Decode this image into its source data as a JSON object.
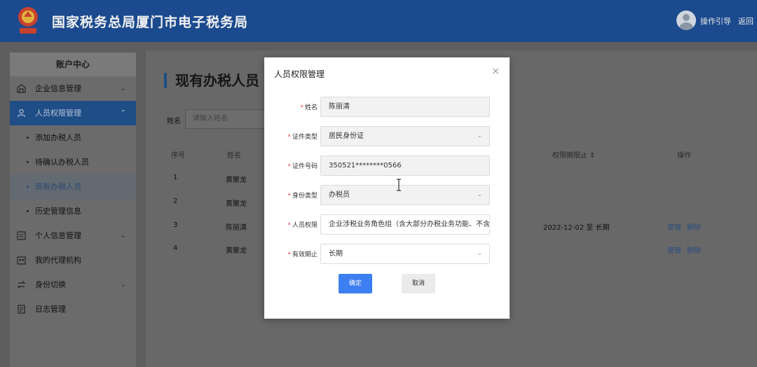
{
  "header": {
    "title": "国家税务总局厦门市电子税务局",
    "guide_label": "操作引导",
    "back_label": "返回",
    "brand_color": "#1b4a8e"
  },
  "sidebar": {
    "heading": "账户中心",
    "items": [
      {
        "label": "企业信息管理",
        "icon": "building-icon",
        "has_chevron": true
      },
      {
        "label": "人员权限管理",
        "icon": "users-icon",
        "has_chevron": true,
        "active": true
      },
      {
        "label": "添加办税人员"
      },
      {
        "label": "待确认办税人员"
      },
      {
        "label": "现有办税人员",
        "current": true
      },
      {
        "label": "历史管理信息"
      },
      {
        "label": "个人信息管理",
        "icon": "profile-icon",
        "has_chevron": true
      },
      {
        "label": "我的代理机构",
        "icon": "agency-icon"
      },
      {
        "label": "身份切换",
        "icon": "switch-icon",
        "has_chevron": true
      },
      {
        "label": "日志管理",
        "icon": "log-icon"
      }
    ]
  },
  "main": {
    "title": "现有办税人员",
    "filter_label": "姓名",
    "filter_placeholder": "请输入姓名",
    "columns": {
      "seq": "序号",
      "name": "姓名",
      "validity": "权限期限止 ⇕",
      "ops": "操作"
    },
    "rows": [
      {
        "seq": "1",
        "name": "黄聚龙",
        "validity": "",
        "manage": "",
        "delete": ""
      },
      {
        "seq": "2",
        "name": "黄聚龙",
        "validity": "",
        "manage": "",
        "delete": ""
      },
      {
        "seq": "3",
        "name": "陈丽清",
        "validity": "2022-12-02 至 长期",
        "manage": "管理",
        "delete": "删除"
      },
      {
        "seq": "4",
        "name": "黄聚龙",
        "validity": "",
        "manage": "管理",
        "delete": "删除"
      }
    ]
  },
  "modal": {
    "title": "人员权限管理",
    "close": "×",
    "fields": {
      "name": {
        "label": "姓名",
        "value": "陈丽清"
      },
      "id_type": {
        "label": "证件类型",
        "value": "居民身份证"
      },
      "id_number": {
        "label": "证件号码",
        "value": "350521********0566"
      },
      "identity_type": {
        "label": "身份类型",
        "value": "办税员"
      },
      "permission": {
        "label": "人员权限",
        "value": "企业涉税业务角色组（含大部分办税业务功能、不含"
      },
      "validity": {
        "label": "有效期止",
        "value": "长期"
      }
    },
    "confirm": "确定",
    "cancel": "取消",
    "accent_color": "#3d7ff0"
  }
}
